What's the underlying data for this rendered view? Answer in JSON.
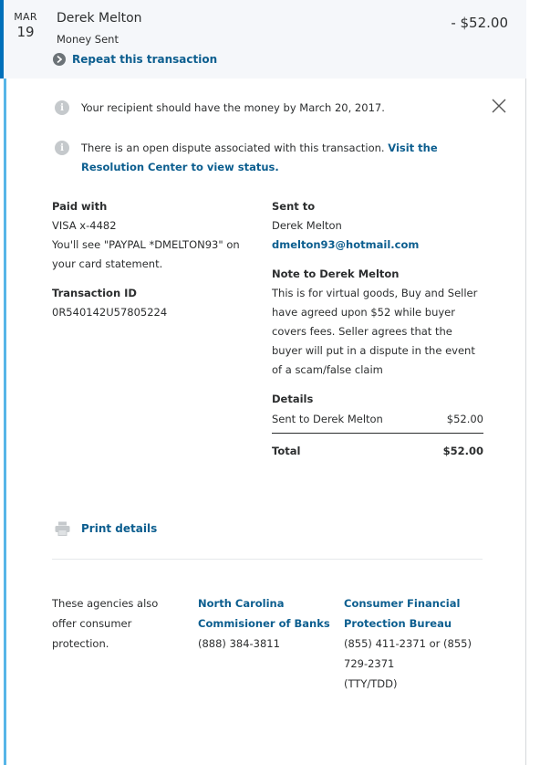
{
  "transaction": {
    "date_month": "MAR",
    "date_day": "19",
    "name": "Derek Melton",
    "type": "Money Sent",
    "amount": "- $52.00",
    "repeat_label": "Repeat this transaction"
  },
  "notices": {
    "delivery": "Your recipient should have the money by March 20, 2017.",
    "dispute_text": "There is an open dispute associated with this transaction.",
    "dispute_link": "Visit the Resolution Center to view status.",
    "info_icon": "info-icon"
  },
  "paid_with": {
    "label": "Paid with",
    "card": "VISA x-4482",
    "statement_note": "You'll see \"PAYPAL *DMELTON93\" on your card statement."
  },
  "transaction_id": {
    "label": "Transaction ID",
    "value": "0R540142U57805224"
  },
  "sent_to": {
    "label": "Sent to",
    "name": "Derek Melton",
    "email": "dmelton93@hotmail.com"
  },
  "note": {
    "label": "Note to Derek Melton",
    "text": "This is for virtual goods, Buy and Seller have agreed upon $52 while buyer covers fees. Seller agrees that the buyer will put in a dispute in the event of a scam/false claim"
  },
  "details": {
    "label": "Details",
    "line_label": "Sent to Derek Melton",
    "line_amount": "$52.00",
    "total_label": "Total",
    "total_amount": "$52.00"
  },
  "print_label": "Print details",
  "agencies": {
    "intro": "These agencies also offer consumer protection.",
    "nc_name": "North Carolina Commisioner of Banks",
    "nc_phone": "(888) 384-3811",
    "cfpb_name": "Consumer Financial Protection Bureau",
    "cfpb_phone": "(855) 411-2371 or (855) 729-2371",
    "cfpb_tty": "(TTY/TDD)"
  },
  "colors": {
    "accent": "#0070ba",
    "link": "#0c5e8f",
    "panel_border": "#57b5e8",
    "header_bg": "#f5f7fa"
  }
}
